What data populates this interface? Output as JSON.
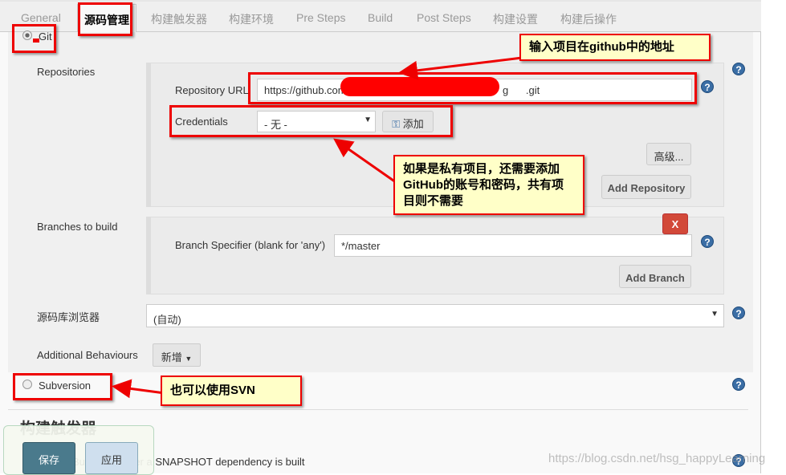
{
  "tabs": [
    {
      "label": "General"
    },
    {
      "label": "源码管理",
      "active": true
    },
    {
      "label": "构建触发器"
    },
    {
      "label": "构建环境"
    },
    {
      "label": "Pre Steps"
    },
    {
      "label": "Build"
    },
    {
      "label": "Post Steps"
    },
    {
      "label": "构建设置"
    },
    {
      "label": "构建后操作"
    }
  ],
  "scm": {
    "git_label": "Git",
    "git_selected": true,
    "repositories_label": "Repositories",
    "repo_url_label": "Repository URL",
    "repo_url_prefix": "https://github.com",
    "repo_url_suffix": "g      .git",
    "credentials_label": "Credentials",
    "credentials_value": "- 无 -",
    "add_label": "添加",
    "advanced_label": "高级...",
    "add_repository_label": "Add Repository",
    "branches_label": "Branches to build",
    "branch_spec_label": "Branch Specifier (blank for 'any')",
    "branch_spec_value": "*/master",
    "delete_label": "X",
    "add_branch_label": "Add Branch",
    "browser_label": "源码库浏览器",
    "browser_value": "(自动)",
    "behaviours_label": "Additional Behaviours",
    "new_label": "新增",
    "subversion_label": "Subversion",
    "help": "?"
  },
  "triggers": {
    "heading": "构建触发器",
    "snapshot_label": "Build whenever a SNAPSHOT dependency is built"
  },
  "footer": {
    "save_label": "保存",
    "apply_label": "应用"
  },
  "annotations": {
    "github_url": "输入项目在github中的地址",
    "credentials": "如果是私有项目，还需要添加GitHub的账号和密码，共有项目则不需要",
    "svn": "也可以使用SVN"
  },
  "watermark": "https://blog.csdn.net/hsg_happyLearning",
  "colors": {
    "annotation_red": "#ee0000",
    "note_bg": "#ffffc8",
    "save_btn": "#4a7a8c",
    "delete_btn": "#d24939"
  }
}
